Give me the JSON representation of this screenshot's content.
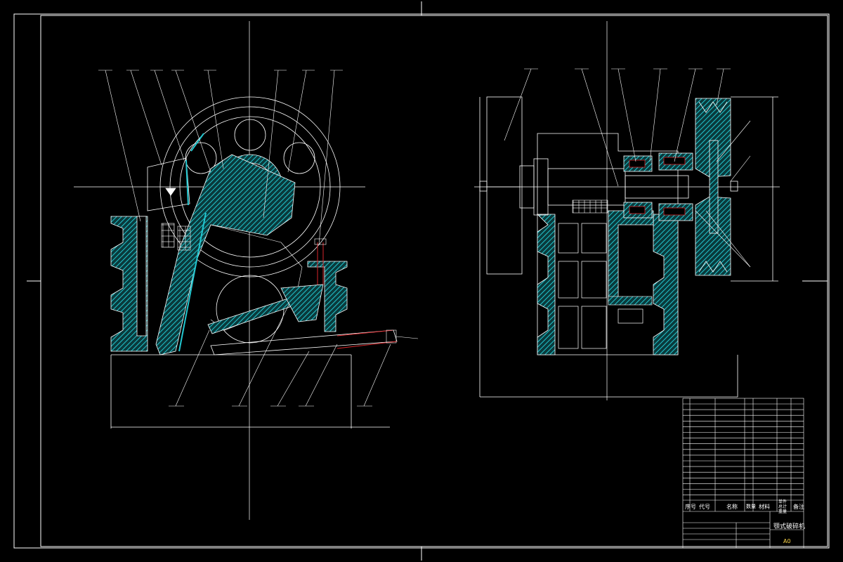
{
  "drawing": {
    "title": "颚式破碎机",
    "sheet_size": "A0",
    "colors": {
      "background": "#000000",
      "line": "#ffffff",
      "section": "#22c6cf",
      "highlight": "#d9262b",
      "accent": "#ffd84a"
    }
  },
  "title_block": {
    "header": {
      "seq": "序号",
      "code": "代号",
      "name": "名称",
      "qty": "数量",
      "material": "材料",
      "weight": "单件 总计 重量",
      "remark": "备注"
    }
  }
}
